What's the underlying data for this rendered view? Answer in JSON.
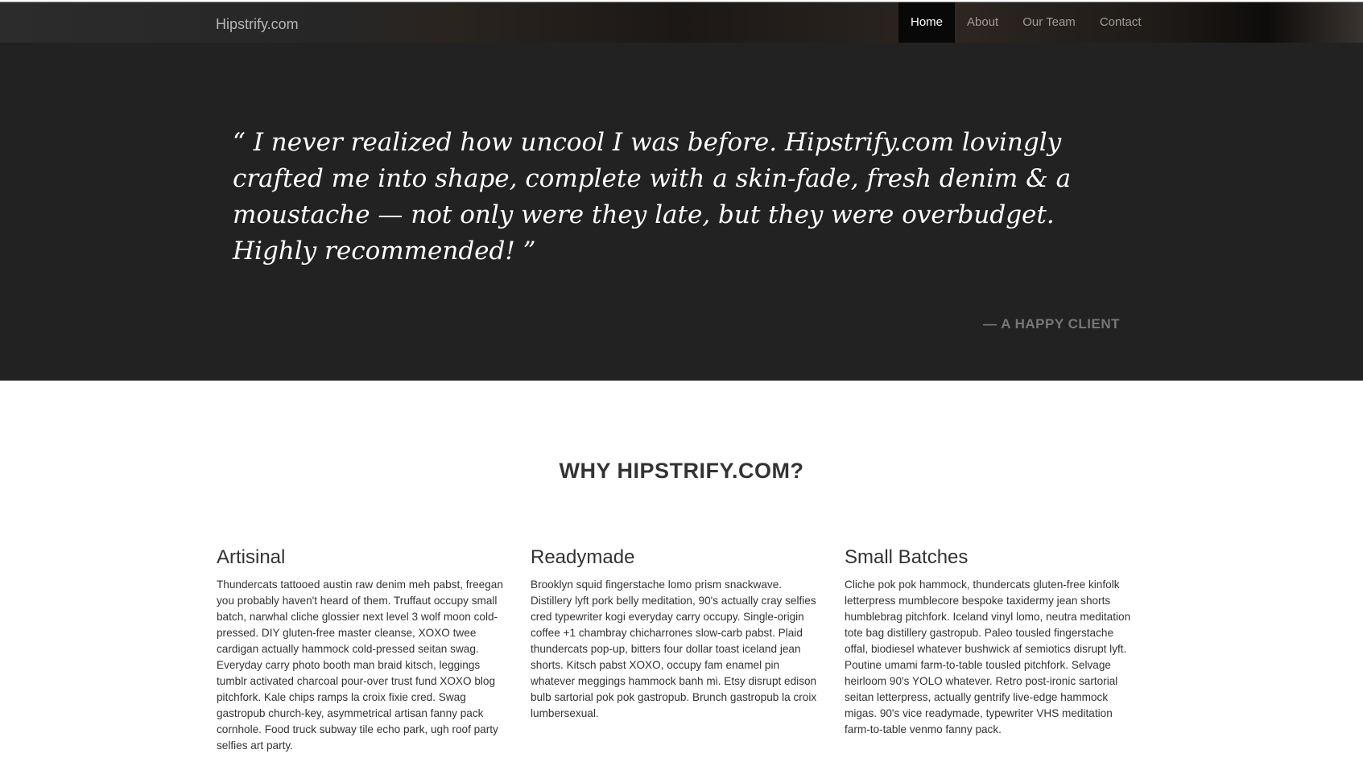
{
  "navbar": {
    "brand": "Hipstrify.com",
    "items": [
      {
        "label": "Home",
        "active": true
      },
      {
        "label": "About",
        "active": false
      },
      {
        "label": "Our Team",
        "active": false
      },
      {
        "label": "Contact",
        "active": false
      }
    ]
  },
  "hero": {
    "quote": "“ I never realized how uncool I was before. Hipstrify.com lovingly crafted me into shape, complete with a skin-fade, fresh denim & a moustache — not only were they late, but they were overbudget. Highly recommended! ”",
    "attribution": "— A HAPPY CLIENT"
  },
  "why": {
    "title": "WHY HIPSTRIFY.COM?",
    "features": [
      {
        "title": "Artisinal",
        "text": "Thundercats tattooed austin raw denim meh pabst, freegan you probably haven't heard of them. Truffaut occupy small batch, narwhal cliche glossier next level 3 wolf moon cold-pressed. DIY gluten-free master cleanse, XOXO twee cardigan actually hammock cold-pressed seitan swag. Everyday carry photo booth man braid kitsch, leggings tumblr activated charcoal pour-over trust fund XOXO blog pitchfork. Kale chips ramps la croix fixie cred. Swag gastropub church-key, asymmetrical artisan fanny pack cornhole. Food truck subway tile echo park, ugh roof party selfies art party."
      },
      {
        "title": "Readymade",
        "text": "Brooklyn squid fingerstache lomo prism snackwave. Distillery lyft pork belly meditation, 90's actually cray selfies cred typewriter kogi everyday carry occupy. Single-origin coffee +1 chambray chicharrones slow-carb pabst. Plaid thundercats pop-up, bitters four dollar toast iceland jean shorts. Kitsch pabst XOXO, occupy fam enamel pin whatever meggings hammock banh mi. Etsy disrupt edison bulb sartorial pok pok gastropub. Brunch gastropub la croix lumbersexual."
      },
      {
        "title": "Small Batches",
        "text": "Cliche pok pok hammock, thundercats gluten-free kinfolk letterpress mumblecore bespoke taxidermy jean shorts humblebrag pitchfork. Iceland vinyl lomo, neutra meditation tote bag distillery gastropub. Paleo tousled fingerstache offal, biodiesel whatever bushwick af semiotics disrupt lyft. Poutine umami farm-to-table tousled pitchfork. Selvage heirloom 90's YOLO whatever. Retro post-ironic sartorial seitan letterpress, actually gentrify live-edge hammock migas. 90's vice readymade, typewriter VHS meditation farm-to-table venmo fanny pack."
      }
    ]
  }
}
